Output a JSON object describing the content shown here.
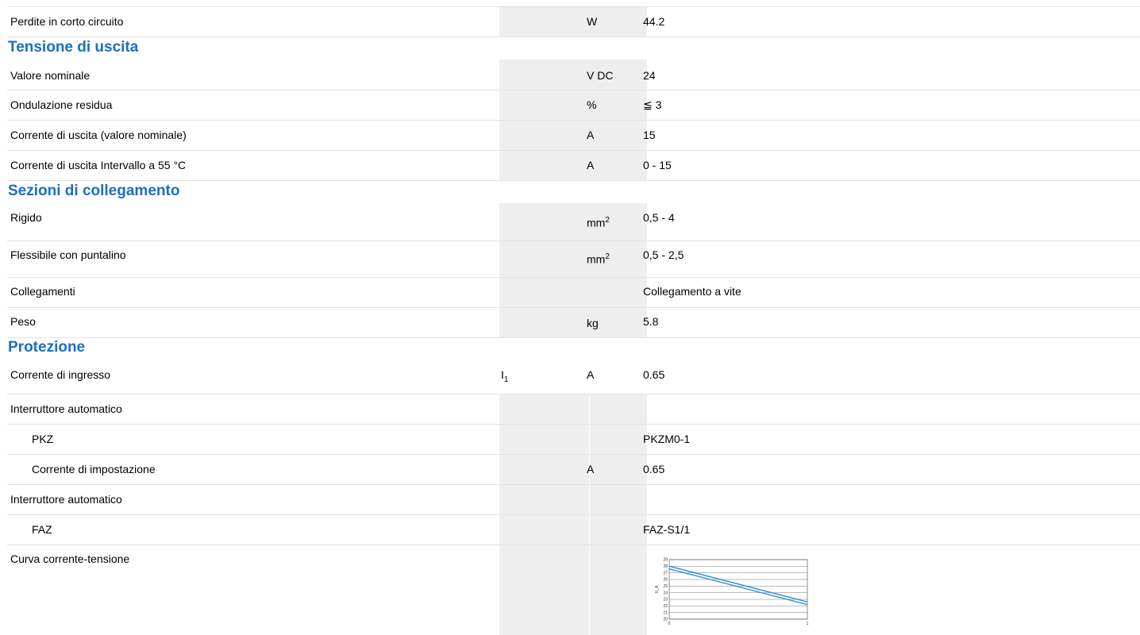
{
  "sections": {
    "output_voltage": "Tensione di uscita",
    "connection_sections": "Sezioni di collegamento",
    "protection": "Protezione"
  },
  "rows": {
    "short_circuit_loss": {
      "label": "Perdite in corto circuito",
      "unit": "W",
      "value": "44.2"
    },
    "nominal_value": {
      "label": "Valore nominale",
      "unit": "V DC",
      "value": "24"
    },
    "residual_ripple": {
      "label": "Ondulazione residua",
      "unit": "%",
      "value": "≦ 3"
    },
    "output_current_nominal": {
      "label": "Corrente di uscita (valore nominale)",
      "unit": "A",
      "value": "15"
    },
    "output_current_range": {
      "label": "Corrente di uscita Intervallo a 55 °C",
      "unit": "A",
      "value": "0 - 15"
    },
    "rigid": {
      "label": "Rigido",
      "unit": "mm",
      "unit_sup": "2",
      "value": "0,5 - 4"
    },
    "flexible_ferrule": {
      "label": "Flessibile con puntalino",
      "unit": "mm",
      "unit_sup": "2",
      "value": "0,5 - 2,5"
    },
    "connections": {
      "label": "Collegamenti",
      "unit": "",
      "value": "Collegamento a vite"
    },
    "weight": {
      "label": "Peso",
      "unit": "kg",
      "value": "5.8"
    },
    "input_current": {
      "label": "Corrente di ingresso",
      "symbol": "I",
      "symbol_sub": "1",
      "unit": "A",
      "value": "0.65"
    },
    "circuit_breaker_1": {
      "label": "Interruttore automatico"
    },
    "pkz": {
      "label": "PKZ",
      "value": "PKZM0-1"
    },
    "setting_current": {
      "label": "Corrente di impostazione",
      "unit": "A",
      "value": "0.65"
    },
    "circuit_breaker_2": {
      "label": "Interruttore automatico"
    },
    "faz": {
      "label": "FAZ",
      "value": "FAZ-S1/1"
    },
    "curve": {
      "label": "Curva corrente-tensione"
    }
  },
  "chart_data": {
    "type": "line",
    "title": "",
    "xlabel": "",
    "ylabel": "U_A",
    "xlim": [
      0,
      1
    ],
    "ylim": [
      20,
      29
    ],
    "y_ticks": [
      "20",
      "21",
      "22",
      "23",
      "24",
      "25",
      "26",
      "27",
      "28",
      "29"
    ],
    "x_ticks": [
      "0",
      "1"
    ],
    "series": [
      {
        "x": [
          0,
          1
        ],
        "y": [
          28.0,
          22.6
        ]
      },
      {
        "x": [
          0,
          1
        ],
        "y": [
          27.6,
          22.2
        ]
      }
    ],
    "colors": [
      "#2a8fd6",
      "#2a8fd6"
    ],
    "grid": true
  }
}
